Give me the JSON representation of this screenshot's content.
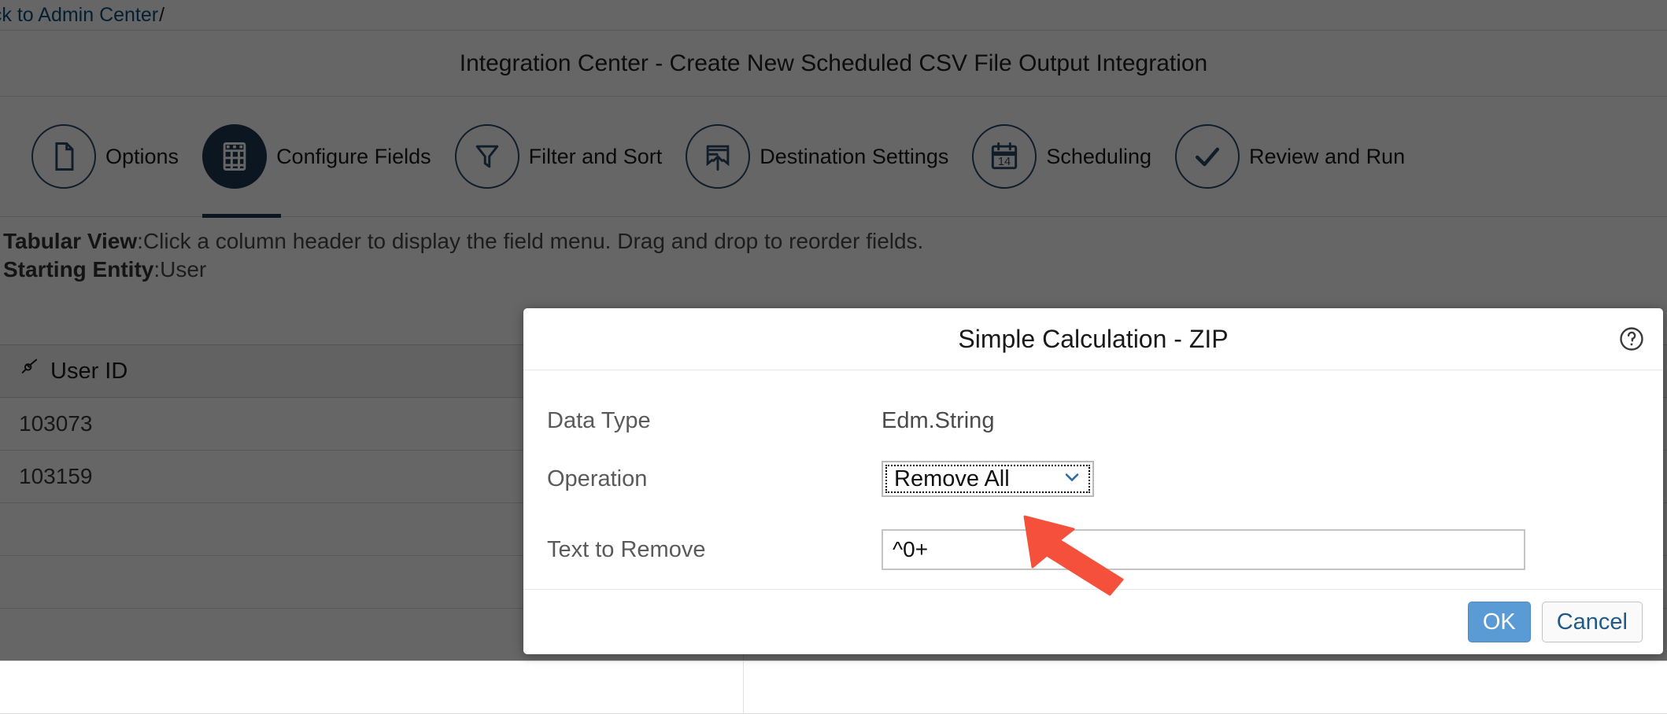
{
  "breadcrumb": {
    "link_label": "ack to Admin Center",
    "separator": "/"
  },
  "header": {
    "title": "Integration Center - Create New Scheduled CSV File Output Integration"
  },
  "wizard": {
    "steps": [
      {
        "label": "Options",
        "icon": "document-icon",
        "active": false
      },
      {
        "label": "Configure Fields",
        "icon": "table-grid-icon",
        "active": true
      },
      {
        "label": "Filter and Sort",
        "icon": "funnel-filter-icon",
        "active": false
      },
      {
        "label": "Destination Settings",
        "icon": "upload-export-icon",
        "active": false
      },
      {
        "label": "Scheduling",
        "icon": "calendar-14-icon",
        "active": false
      },
      {
        "label": "Review and Run",
        "icon": "checkmark-icon",
        "active": false
      }
    ],
    "calendar_day": "14"
  },
  "instructions": {
    "tabular_view_label": "Tabular View",
    "tabular_view_text": ":Click a column header to display the field menu. Drag and drop to reorder fields.",
    "starting_entity_label": "Starting Entity",
    "starting_entity_text": ":User"
  },
  "table": {
    "columns": [
      {
        "label": "User ID",
        "icon": "key-icon"
      },
      {
        "label": "",
        "icon": ""
      }
    ],
    "rows": [
      [
        "103073",
        ""
      ],
      [
        "103159",
        ""
      ],
      [
        "",
        ""
      ],
      [
        "",
        ""
      ],
      [
        "",
        ""
      ],
      [
        "",
        ""
      ]
    ]
  },
  "modal": {
    "title": "Simple Calculation - ZIP",
    "help_icon": "help-circle-icon",
    "fields": {
      "data_type_label": "Data Type",
      "data_type_value": "Edm.String",
      "operation_label": "Operation",
      "operation_value": "Remove All",
      "operation_options": [
        "Remove All"
      ],
      "text_to_remove_label": "Text to Remove",
      "text_to_remove_value": "^0+",
      "text_to_remove_placeholder": ""
    },
    "buttons": {
      "ok_label": "OK",
      "cancel_label": "Cancel"
    }
  },
  "colors": {
    "accent_blue": "#5b9bd5",
    "wizard_active": "#1d3750",
    "wizard_outline": "#2b4a66",
    "link_blue": "#0a4e7d",
    "annotation_red": "#f44336"
  },
  "annotation": {
    "arrow": "red-arrow-pointing-to-text-to-remove-field"
  }
}
